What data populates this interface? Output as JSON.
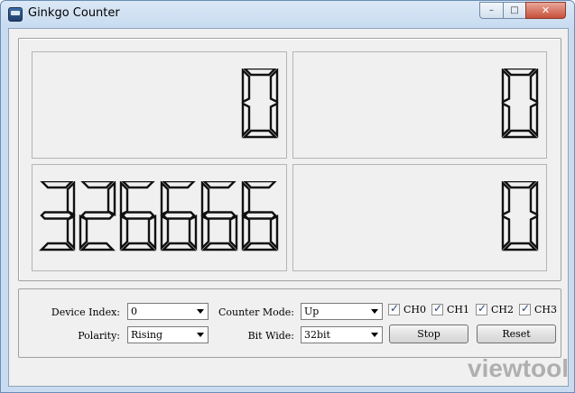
{
  "window": {
    "title": "Ginkgo Counter"
  },
  "caption_buttons": {
    "minimize": "–",
    "maximize": "□",
    "close": "✕"
  },
  "counters": [
    {
      "value": "0"
    },
    {
      "value": "0"
    },
    {
      "value": "326666"
    },
    {
      "value": "0"
    }
  ],
  "controls": {
    "device_index": {
      "label": "Device Index:",
      "value": "0"
    },
    "counter_mode": {
      "label": "Counter Mode:",
      "value": "Up"
    },
    "polarity": {
      "label": "Polarity:",
      "value": "Rising"
    },
    "bit_wide": {
      "label": "Bit Wide:",
      "value": "32bit"
    },
    "channels": [
      {
        "label": "CH0",
        "checked": true
      },
      {
        "label": "CH1",
        "checked": true
      },
      {
        "label": "CH2",
        "checked": true
      },
      {
        "label": "CH3",
        "checked": true
      }
    ],
    "stop_label": "Stop",
    "reset_label": "Reset"
  },
  "watermark": {
    "text": "viewtool"
  },
  "colors": {
    "segment": "#111111",
    "background": "#f0f0f0"
  }
}
